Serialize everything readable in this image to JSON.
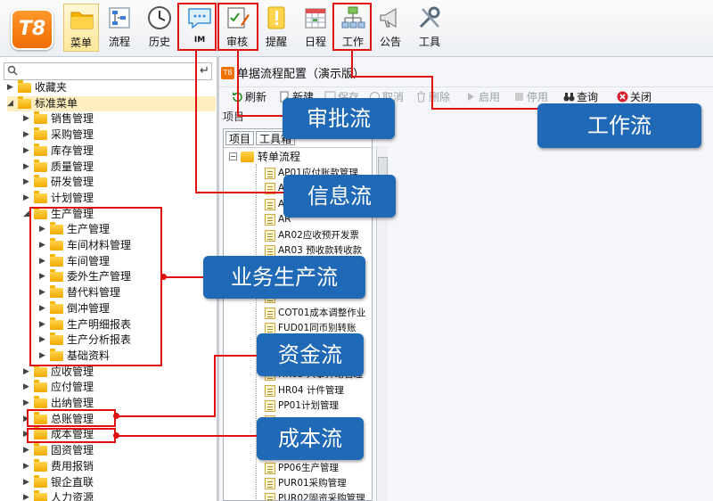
{
  "app": {
    "logo": "T8"
  },
  "toolbar": {
    "items": [
      {
        "label": "菜单",
        "icon": "folder-icon"
      },
      {
        "label": "流程",
        "icon": "flowchart-icon"
      },
      {
        "label": "历史",
        "icon": "clock-icon"
      },
      {
        "label": "",
        "icon": "im-chat-icon",
        "icon_text": "IM"
      },
      {
        "label": "审核",
        "icon": "approve-pen-icon"
      },
      {
        "label": "提醒",
        "icon": "reminder-icon"
      },
      {
        "label": "日程",
        "icon": "calendar-icon"
      },
      {
        "label": "工作",
        "icon": "org-chart-icon"
      },
      {
        "label": "公告",
        "icon": "megaphone-icon"
      },
      {
        "label": "工具",
        "icon": "tools-icon"
      }
    ]
  },
  "tree": {
    "favorites": "收藏夹",
    "standard": "标准菜单",
    "modules1": [
      "销售管理",
      "采购管理",
      "库存管理",
      "质量管理",
      "研发管理",
      "计划管理"
    ],
    "production": "生产管理",
    "production_children": [
      "生产管理",
      "车间材料管理",
      "车间管理",
      "委外生产管理",
      "替代料管理",
      "倒冲管理",
      "生产明细报表",
      "生产分析报表",
      "基础资料"
    ],
    "modules2": [
      "应收管理",
      "应付管理",
      "出纳管理",
      "总账管理",
      "成本管理",
      "固资管理",
      "费用报销",
      "银企直联",
      "人力资源"
    ]
  },
  "panel": {
    "title": "单据流程配置（演示版）",
    "buttons": [
      "刷新",
      "新建",
      "保存",
      "取消",
      "删除",
      "启用",
      "停用",
      "查询",
      "关闭"
    ],
    "section_label": "项目",
    "tabs": [
      "项目",
      "工具箱"
    ],
    "root": "转单流程",
    "items": [
      "AP01应付账款管理",
      "AP",
      "AR",
      "AR",
      "AR02应收预开发票",
      "AR03 预收款转收款",
      "AR04 收款作业",
      "",
      "",
      "COT01成本调整作业",
      "FUD01同币别转账",
      "",
      "",
      "HR03 人事异动管理",
      "HR04 计件管理",
      "PP01计划管理",
      "",
      "",
      "",
      "PP06生产管理",
      "PUR01采购管理",
      "PUR02固资采购管理"
    ]
  },
  "callouts": {
    "approval": "审批流",
    "work": "工作流",
    "info": "信息流",
    "business": "业务生产流",
    "fund": "资金流",
    "cost": "成本流"
  },
  "colors": {
    "callout": "#1f69b7",
    "highlight": "#e01010",
    "logo": "#f07000"
  }
}
